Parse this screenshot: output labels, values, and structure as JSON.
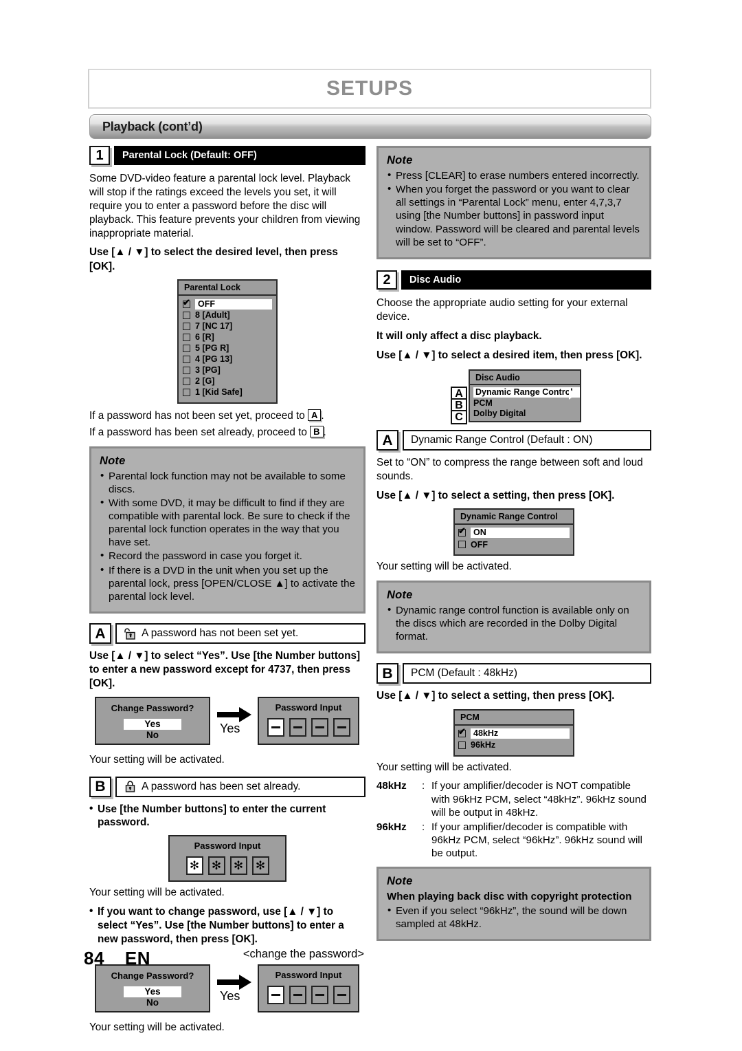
{
  "header": {
    "title": "SETUPS",
    "section_bar": "Playback (cont’d)"
  },
  "footer": {
    "page_number": "84",
    "language": "EN"
  },
  "left": {
    "section1": {
      "number": "1",
      "title": "Parental Lock (Default: OFF)",
      "intro": "Some DVD-video feature a parental lock level. Playback will stop if the ratings exceed the levels you set, it will require you to enter a password before the disc will playback. This feature prevents your children from viewing inappropriate material.",
      "instruction": "Use [▲ / ▼] to select the desired level, then press [OK].",
      "menu": {
        "title": "Parental Lock",
        "items": [
          {
            "label": "OFF",
            "checked": true,
            "selected": true
          },
          {
            "label": "8 [Adult]",
            "checked": false,
            "selected": false
          },
          {
            "label": "7 [NC 17]",
            "checked": false,
            "selected": false
          },
          {
            "label": "6 [R]",
            "checked": false,
            "selected": false
          },
          {
            "label": "5 [PG R]",
            "checked": false,
            "selected": false
          },
          {
            "label": "4 [PG 13]",
            "checked": false,
            "selected": false
          },
          {
            "label": "3 [PG]",
            "checked": false,
            "selected": false
          },
          {
            "label": "2 [G]",
            "checked": false,
            "selected": false
          },
          {
            "label": "1 [Kid Safe]",
            "checked": false,
            "selected": false
          }
        ]
      },
      "proceed_a": "If a password has not been set yet, proceed to",
      "proceed_a_ref": "A",
      "proceed_a_end": ".",
      "proceed_b": "If a password has been set already, proceed to",
      "proceed_b_ref": "B",
      "proceed_b_end": "."
    },
    "note1": {
      "title": "Note",
      "items": [
        "Parental lock function may not be available to some discs.",
        "With some DVD, it may be difficult to find if they are compatible with parental lock. Be sure to check if the parental lock function operates in the way that you have set.",
        "Record the password in case you forget it.",
        "If there is a DVD in the unit when you set up the parental lock, press [OPEN/CLOSE ▲] to activate the parental lock level."
      ]
    },
    "blockA": {
      "letter": "A",
      "icon": "unlocked-padlock-icon",
      "title": "A password has not been set yet.",
      "instruction": "Use [▲ / ▼] to select “Yes”. Use [the Number buttons] to enter a new password except for 4737, then press [OK].",
      "flow": {
        "left_title": "Change Password?",
        "left_yes": "Yes",
        "left_no": "No",
        "arrow_label": "Yes",
        "right_title": "Password Input",
        "digits": [
          "—",
          "—",
          "—",
          "—"
        ]
      },
      "activated": "Your setting will be activated."
    },
    "blockB": {
      "letter": "B",
      "icon": "locked-padlock-icon",
      "title": "A password has been set already.",
      "instruction": "Use [the Number buttons] to enter the current password.",
      "pwd": {
        "title": "Password Input",
        "digits": [
          "✻",
          "✻",
          "✻",
          "✻"
        ]
      },
      "activated": "Your setting will be activated.",
      "change_instruction": "If you want to change password, use [▲ / ▼] to select “Yes”. Use [the Number buttons] to enter a new password, then press [OK].",
      "change_caption": "<change the password>",
      "flow": {
        "left_title": "Change Password?",
        "left_yes": "Yes",
        "left_no": "No",
        "arrow_label": "Yes",
        "right_title": "Password Input",
        "digits": [
          "—",
          "—",
          "—",
          "—"
        ]
      },
      "activated2": "Your setting will be activated."
    }
  },
  "right": {
    "note_top": {
      "title": "Note",
      "items": [
        "Press [CLEAR] to erase numbers entered incorrectly.",
        "When you forget the password or you want to clear all settings in “Parental Lock” menu, enter 4,7,3,7 using [the Number buttons] in password input window. Password will be cleared and parental levels will be set to “OFF”."
      ]
    },
    "section2": {
      "number": "2",
      "title": "Disc Audio",
      "intro": "Choose the appropriate audio setting for your external device.",
      "bold_note": "It will only affect a disc playback.",
      "instruction": "Use [▲ / ▼] to select a desired item, then press [OK].",
      "menu": {
        "title": "Disc Audio",
        "items": [
          {
            "letter": "A",
            "label": "Dynamic Range Control",
            "selected": true
          },
          {
            "letter": "B",
            "label": "PCM",
            "selected": false
          },
          {
            "letter": "C",
            "label": "Dolby Digital",
            "selected": false
          }
        ]
      }
    },
    "blockA": {
      "letter": "A",
      "title": "Dynamic Range Control (Default : ON)",
      "body": "Set to “ON” to compress the range between soft and loud sounds.",
      "instruction": "Use [▲ / ▼] to select a setting, then press [OK].",
      "menu": {
        "title": "Dynamic Range Control",
        "items": [
          {
            "label": "ON",
            "checked": true,
            "selected": true
          },
          {
            "label": "OFF",
            "checked": false,
            "selected": false
          }
        ]
      },
      "activated": "Your setting will be activated."
    },
    "note_drc": {
      "title": "Note",
      "items": [
        "Dynamic range control function is available only on the discs which are recorded in the Dolby Digital format."
      ]
    },
    "blockB": {
      "letter": "B",
      "title": "PCM (Default : 48kHz)",
      "instruction": "Use [▲ / ▼] to select a setting, then press [OK].",
      "menu": {
        "title": "PCM",
        "items": [
          {
            "label": "48kHz",
            "checked": true,
            "selected": true
          },
          {
            "label": "96kHz",
            "checked": false,
            "selected": false
          }
        ]
      },
      "activated": "Your setting will be activated.",
      "definitions": [
        {
          "term": "48kHz",
          "colon": ":",
          "text": "If your amplifier/decoder is NOT compatible with 96kHz PCM, select “48kHz”. 96kHz sound will be output in 48kHz."
        },
        {
          "term": "96kHz",
          "colon": ":",
          "text": "If your amplifier/decoder is compatible with 96kHz PCM, select “96kHz”. 96kHz sound will be output."
        }
      ]
    },
    "note_copyright": {
      "title": "Note",
      "subtitle": "When playing back disc with copyright protection",
      "items": [
        "Even if you select “96kHz”, the sound will be down sampled at 48kHz."
      ]
    }
  }
}
